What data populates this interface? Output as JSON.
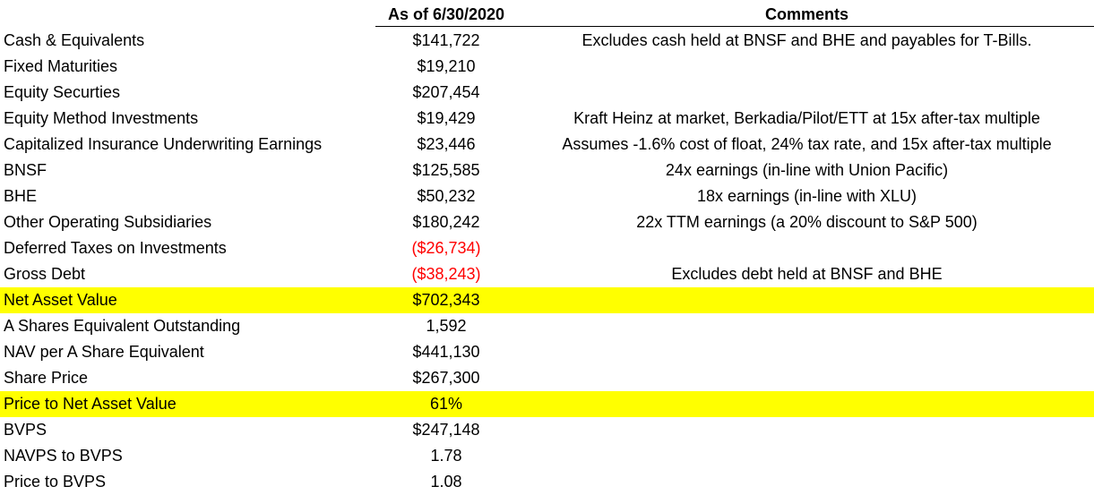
{
  "headers": {
    "value": "As of 6/30/2020",
    "comments": "Comments"
  },
  "colors": {
    "highlight": "#ffff00",
    "negative": "#ff0000"
  },
  "rows": [
    {
      "label": "Cash & Equivalents",
      "value": "$141,722",
      "comment": "Excludes cash held at BNSF and BHE and payables for T-Bills."
    },
    {
      "label": "Fixed Maturities",
      "value": "$19,210",
      "comment": ""
    },
    {
      "label": "Equity Securties",
      "value": "$207,454",
      "comment": ""
    },
    {
      "label": "Equity Method Investments",
      "value": "$19,429",
      "comment": "Kraft Heinz at market, Berkadia/Pilot/ETT at 15x after-tax multiple"
    },
    {
      "label": "Capitalized Insurance Underwriting Earnings",
      "value": "$23,446",
      "comment": "Assumes -1.6% cost of float, 24% tax rate, and 15x after-tax multiple"
    },
    {
      "label": "BNSF",
      "value": "$125,585",
      "comment": "24x earnings (in-line with Union Pacific)"
    },
    {
      "label": "BHE",
      "value": "$50,232",
      "comment": "18x earnings (in-line with XLU)"
    },
    {
      "label": "Other Operating Subsidiaries",
      "value": "$180,242",
      "comment": "22x TTM earnings (a 20% discount to S&P 500)"
    },
    {
      "label": "Deferred Taxes on Investments",
      "value": "($26,734)",
      "comment": "",
      "negative": true
    },
    {
      "label": "Gross Debt",
      "value": "($38,243)",
      "comment": "Excludes debt held at BNSF and BHE",
      "negative": true
    },
    {
      "label": "Net Asset Value",
      "value": "$702,343",
      "comment": "",
      "highlight": true
    },
    {
      "label": "A Shares Equivalent Outstanding",
      "value": "1,592",
      "comment": ""
    },
    {
      "label": "NAV per A Share Equivalent",
      "value": "$441,130",
      "comment": ""
    },
    {
      "label": "Share Price",
      "value": "$267,300",
      "comment": ""
    },
    {
      "label": "Price to Net Asset Value",
      "value": "61%",
      "comment": "",
      "highlight": true
    },
    {
      "label": "BVPS",
      "value": "$247,148",
      "comment": ""
    },
    {
      "label": "NAVPS to BVPS",
      "value": "1.78",
      "comment": ""
    },
    {
      "label": "Price to BVPS",
      "value": "1.08",
      "comment": ""
    }
  ]
}
